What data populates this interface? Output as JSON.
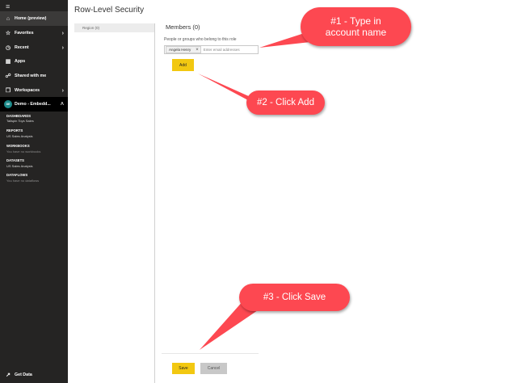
{
  "sidebar": {
    "nav": [
      {
        "label": "Home (preview)",
        "icon": "home-icon"
      },
      {
        "label": "Favorites",
        "icon": "star-icon"
      },
      {
        "label": "Recent",
        "icon": "clock-icon"
      },
      {
        "label": "Apps",
        "icon": "apps-icon"
      },
      {
        "label": "Shared with me",
        "icon": "share-icon"
      },
      {
        "label": "Workspaces",
        "icon": "workspaces-icon"
      }
    ],
    "workspace": {
      "label": "Demo - Embedd...",
      "avatar": "DE"
    },
    "sections": [
      {
        "heading": "DASHBOARDS",
        "item": "Tailspin Toys Sales",
        "muted": false
      },
      {
        "heading": "REPORTS",
        "item": "US Sales Analysis",
        "muted": false
      },
      {
        "heading": "WORKBOOKS",
        "item": "You have no workbooks",
        "muted": true
      },
      {
        "heading": "DATASETS",
        "item": "US Sales Analysis",
        "muted": false
      },
      {
        "heading": "DATAFLOWS",
        "item": "You have no dataflows",
        "muted": true
      }
    ],
    "get_data": "Get Data"
  },
  "main": {
    "title": "Row-Level Security",
    "roles": [
      {
        "label": "Region (0)"
      }
    ],
    "members_title": "Members (0)",
    "members_label": "People or groups who belong to this role",
    "chip": "Angela Henry",
    "email_placeholder": "Enter email addresses",
    "add_label": "Add",
    "save_label": "Save",
    "cancel_label": "Cancel"
  },
  "callouts": {
    "step1_line1": "#1 - Type in",
    "step1_line2": "account name",
    "step2": "#2 - Click Add",
    "step3": "#3 - Click Save"
  },
  "colors": {
    "accent": "#f2c811",
    "callout": "#fd4851",
    "sidebar": "#252423"
  }
}
